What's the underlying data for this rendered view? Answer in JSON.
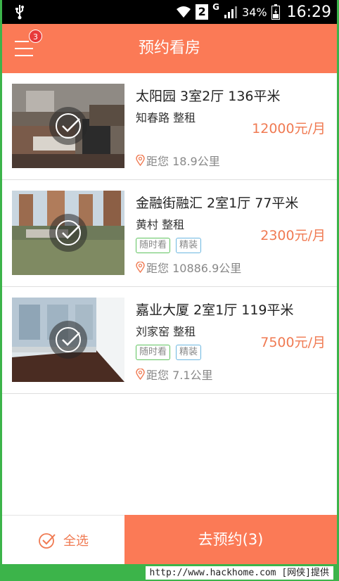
{
  "status_bar": {
    "sim_slot": "2",
    "network_type": "G",
    "battery": "34%",
    "time": "16:29",
    "icons": [
      "usb-icon",
      "wifi-icon",
      "signal-icon",
      "battery-icon"
    ]
  },
  "header": {
    "title": "预约看房",
    "menu_badge": "3",
    "icon": "menu-icon"
  },
  "listings": [
    {
      "title": "太阳园  3室2厅  136平米",
      "subtitle": "知春路  整租",
      "tags": [],
      "price": "12000元/月",
      "distance": "距您 18.9公里",
      "selected": true
    },
    {
      "title": "金融街融汇  2室1厅  77平米",
      "subtitle": "黄村  整租",
      "tags": [
        "随时看",
        "精装"
      ],
      "price": "2300元/月",
      "distance": "距您 10886.9公里",
      "selected": true
    },
    {
      "title": "嘉业大厦  2室1厅  119平米",
      "subtitle": "刘家窑  整租",
      "tags": [
        "随时看",
        "精装"
      ],
      "price": "7500元/月",
      "distance": "距您 7.1公里",
      "selected": true
    }
  ],
  "bottom": {
    "select_all": "全选",
    "book_button": "去预约(3)"
  },
  "watermark": "http://www.hackhome.com [网侠]提供",
  "colors": {
    "accent": "#fb7a56",
    "price": "#f07a52",
    "tag_green": "#5fc35f",
    "tag_blue": "#6cb7e0",
    "frame_green": "#3cb44a"
  }
}
